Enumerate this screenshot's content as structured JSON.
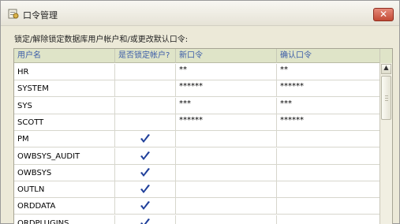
{
  "window": {
    "title": "口令管理"
  },
  "instruction": "锁定/解除锁定数据库用户帐户和/或更改默认口令:",
  "columns": [
    "用户名",
    "是否锁定帐户?",
    "新口令",
    "确认口令"
  ],
  "rows": [
    {
      "user": "HR",
      "locked": false,
      "new_pw": "**",
      "confirm_pw": "**"
    },
    {
      "user": "SYSTEM",
      "locked": false,
      "new_pw": "******",
      "confirm_pw": "******"
    },
    {
      "user": "SYS",
      "locked": false,
      "new_pw": "***",
      "confirm_pw": "***"
    },
    {
      "user": "SCOTT",
      "locked": false,
      "new_pw": "******",
      "confirm_pw": "******"
    },
    {
      "user": "PM",
      "locked": true,
      "new_pw": "",
      "confirm_pw": ""
    },
    {
      "user": "OWBSYS_AUDIT",
      "locked": true,
      "new_pw": "",
      "confirm_pw": ""
    },
    {
      "user": "OWBSYS",
      "locked": true,
      "new_pw": "",
      "confirm_pw": ""
    },
    {
      "user": "OUTLN",
      "locked": true,
      "new_pw": "",
      "confirm_pw": ""
    },
    {
      "user": "ORDDATA",
      "locked": true,
      "new_pw": "",
      "confirm_pw": ""
    },
    {
      "user": "ORDPLUGINS",
      "locked": true,
      "new_pw": "",
      "confirm_pw": ""
    }
  ],
  "icons": {
    "window": "key-lock-icon",
    "close": "close-icon",
    "check": "checkmark-icon",
    "scroll_up": "scroll-up-arrow-icon"
  },
  "colors": {
    "header_text": "#3b5ca8",
    "check": "#1f3f9a",
    "close_button": "#c24a35"
  }
}
